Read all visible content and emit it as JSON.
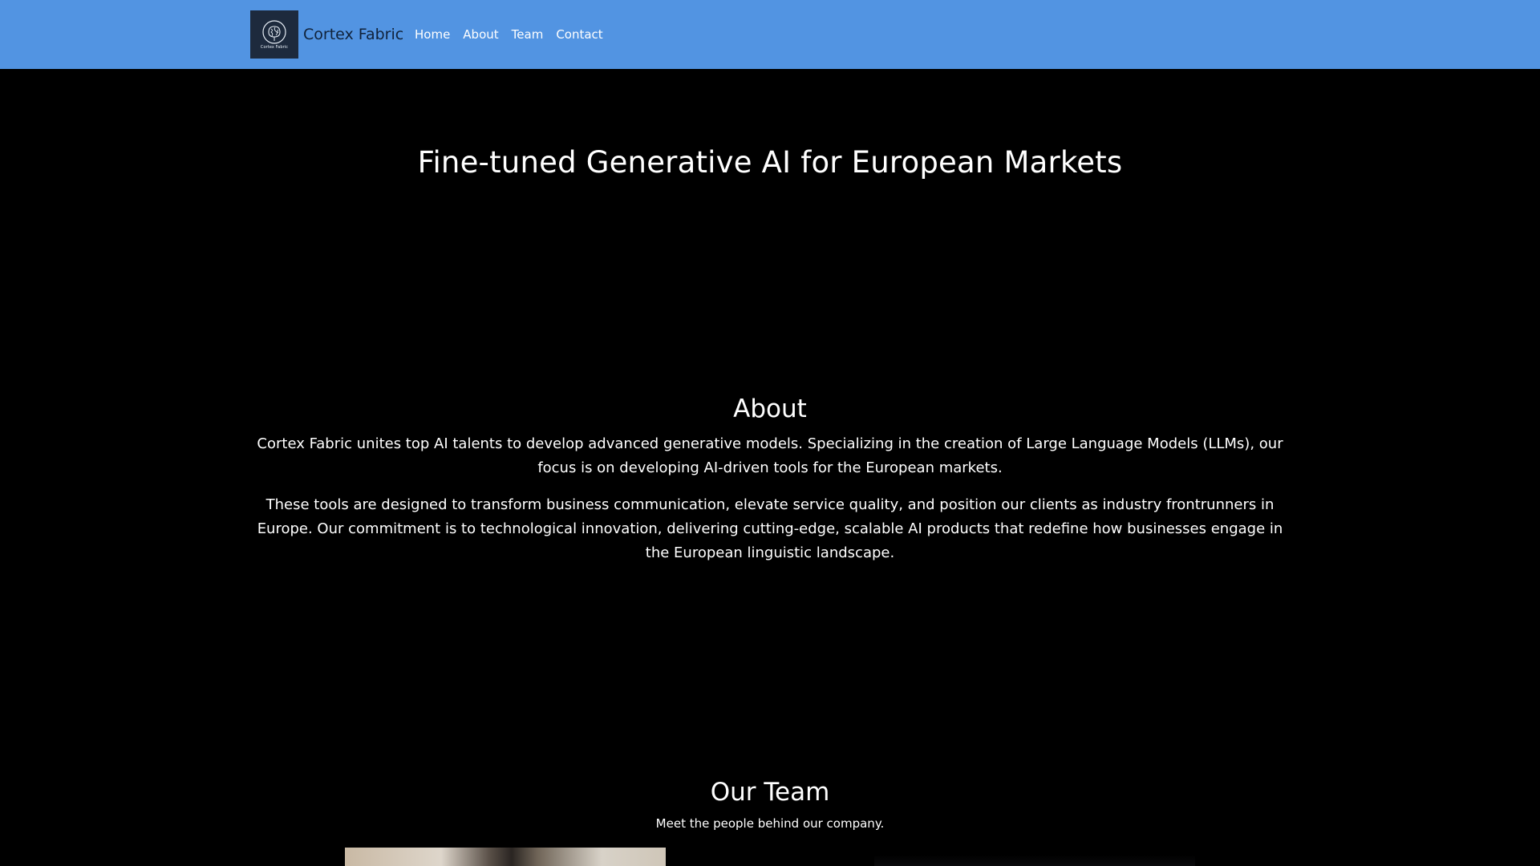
{
  "navbar": {
    "brand_name": "Cortex Fabric",
    "logo_text": "Cortex Fabric",
    "links": [
      "Home",
      "About",
      "Team",
      "Contact"
    ],
    "background": "#5294e2"
  },
  "hero": {
    "title": "Fine-tuned Generative AI for European Markets"
  },
  "about": {
    "title": "About",
    "paragraph1": "Cortex Fabric unites top AI talents to develop advanced generative models. Specializing in the creation of Large Language Models (LLMs), our focus is on developing AI-driven tools for the European markets.",
    "paragraph2": "These tools are designed to transform business communication, elevate service quality, and position our clients as industry frontrunners in Europe. Our commitment is to technological innovation, delivering cutting-edge, scalable AI products that redefine how businesses engage in the European linguistic landscape."
  },
  "team": {
    "title": "Our Team",
    "subtitle": "Meet the people behind our company."
  },
  "colors": {
    "page_background": "#000000",
    "text": "#ffffff",
    "logo_background": "#1d2a3d"
  }
}
